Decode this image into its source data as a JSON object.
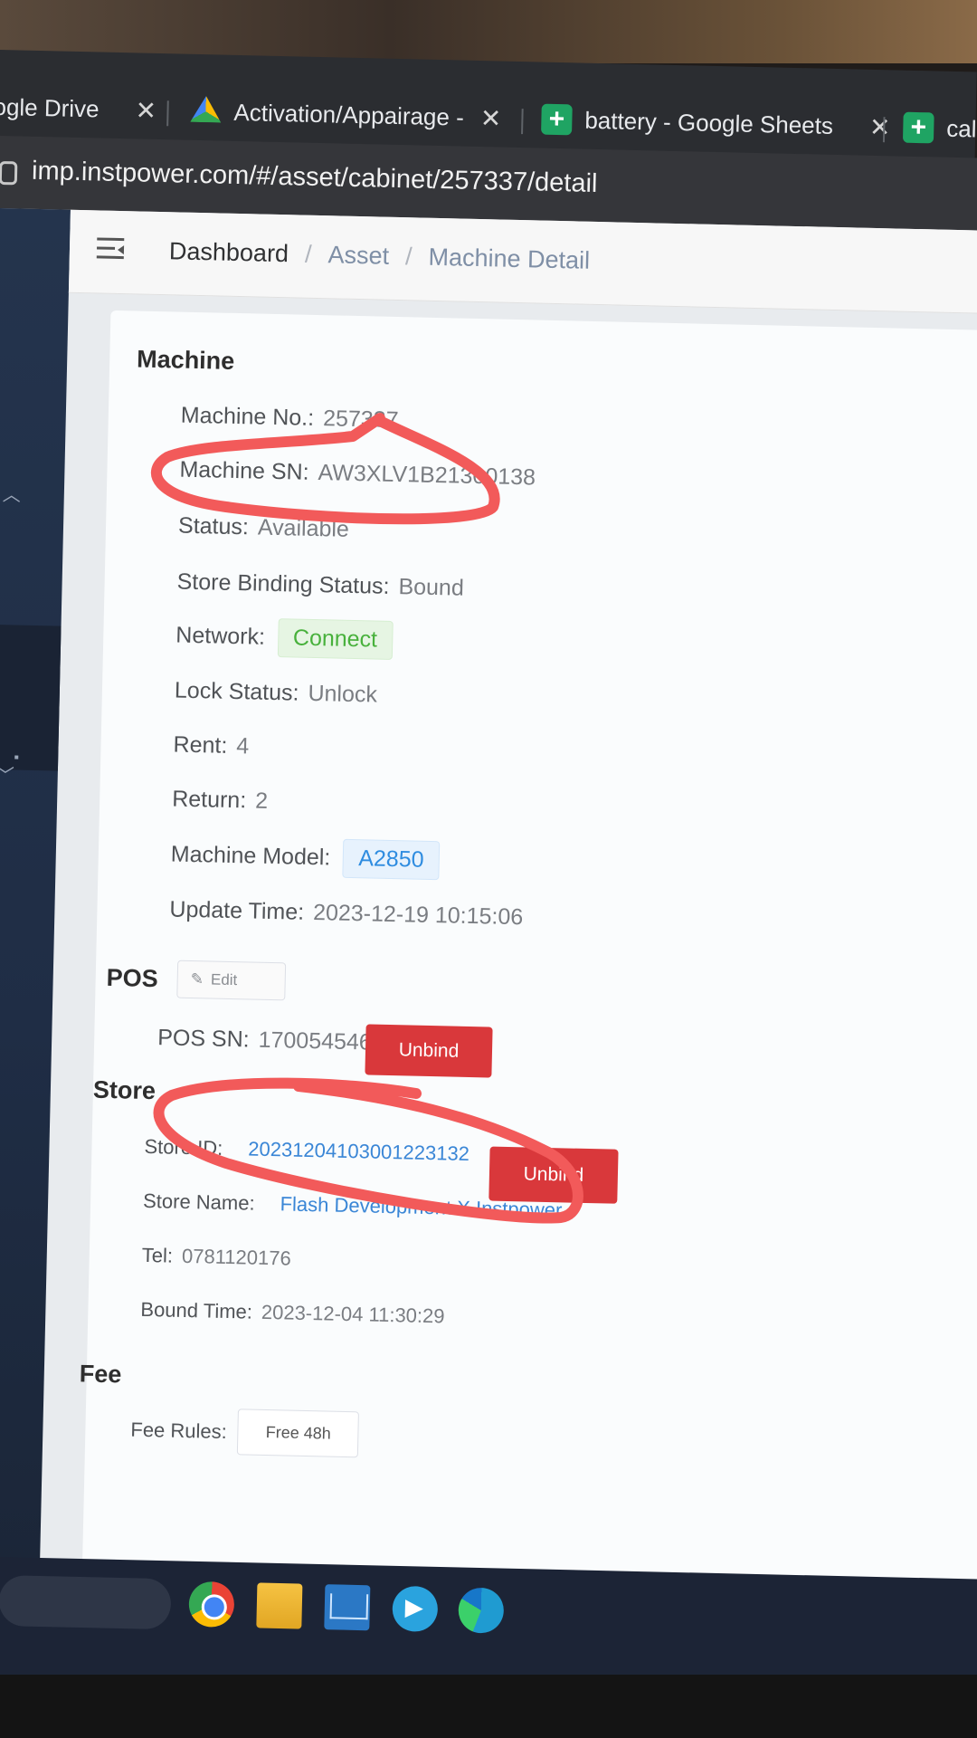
{
  "browser": {
    "tabs": [
      {
        "title": "ogle Drive",
        "icon": "google-drive-icon"
      },
      {
        "title": "Activation/Appairage - ",
        "icon": "google-drive-icon"
      },
      {
        "title": "battery - Google Sheets",
        "icon": "google-sheets-icon"
      },
      {
        "title": "cal",
        "icon": "google-sheets-icon"
      }
    ],
    "url": "imp.instpower.com/#/asset/cabinet/257337/detail"
  },
  "breadcrumb": {
    "items": [
      "Dashboard",
      "Asset",
      "Machine Detail"
    ],
    "separator": "/"
  },
  "machine": {
    "title": "Machine",
    "machine_no_label": "Machine No.:",
    "machine_no": "257337",
    "machine_sn_label": "Machine SN:",
    "machine_sn": "AW3XLV1B21300138",
    "status_label": "Status:",
    "status": "Available",
    "store_binding_label": "Store Binding Status:",
    "store_binding": "Bound",
    "network_label": "Network:",
    "network": "Connect",
    "lock_label": "Lock Status:",
    "lock": "Unlock",
    "rent_label": "Rent:",
    "rent": "4",
    "return_label": "Return:",
    "return": "2",
    "model_label": "Machine Model:",
    "model": "A2850",
    "update_label": "Update Time:",
    "update_time": "2023-12-19 10:15:06"
  },
  "pos": {
    "title": "POS",
    "edit_label": "Edit",
    "sn_label": "POS SN:",
    "sn": "1700545464",
    "unbind_label": "Unbind"
  },
  "store": {
    "title": "Store",
    "id_label": "Store ID:",
    "id": "20231204103001223132",
    "name_label": "Store Name:",
    "name": "Flash Development X Instpower",
    "tel_label": "Tel:",
    "tel": "0781120176",
    "bound_label": "Bound Time:",
    "bound_time": "2023-12-04 11:30:29",
    "unbind_label": "Unbind"
  },
  "fee": {
    "title": "Fee",
    "rules_label": "Fee Rules:",
    "rules": "Free 48h"
  },
  "colors": {
    "danger": "#d9383b",
    "success": "#48b13c",
    "primary": "#2e8ce0",
    "annotation": "#f25a5a"
  },
  "taskbar": {
    "icons": [
      "chrome-icon",
      "file-explorer-icon",
      "mail-icon",
      "telegram-icon",
      "edge-icon"
    ]
  }
}
